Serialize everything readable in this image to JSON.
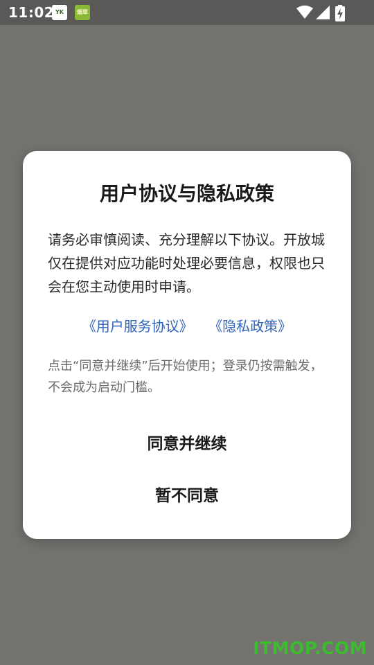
{
  "status_bar": {
    "time": "11:02",
    "notifications": [
      {
        "icon": "yk-app-icon",
        "text": "YK"
      },
      {
        "icon": "green-app-icon",
        "text": "烟草"
      }
    ],
    "system_icons": [
      "wifi-icon",
      "cellular-signal-icon",
      "battery-charging-icon"
    ]
  },
  "dialog": {
    "title": "用户协议与隐私政策",
    "body": "请务必审慎阅读、充分理解以下协议。开放城仅在提供对应功能时处理必要信息，权限也只会在您主动使用时申请。",
    "links": {
      "user_agreement": "《用户服务协议》",
      "privacy_policy": "《隐私政策》"
    },
    "note": "点击“同意并继续”后开始使用；登录仍按需触发，不会成为启动门槛。",
    "buttons": {
      "agree": "同意并继续",
      "decline": "暂不同意"
    }
  },
  "watermark": "ITMOP.COM",
  "colors": {
    "overlay": "#747370",
    "link": "#2f63b8",
    "watermark": "#3dbb2f"
  }
}
